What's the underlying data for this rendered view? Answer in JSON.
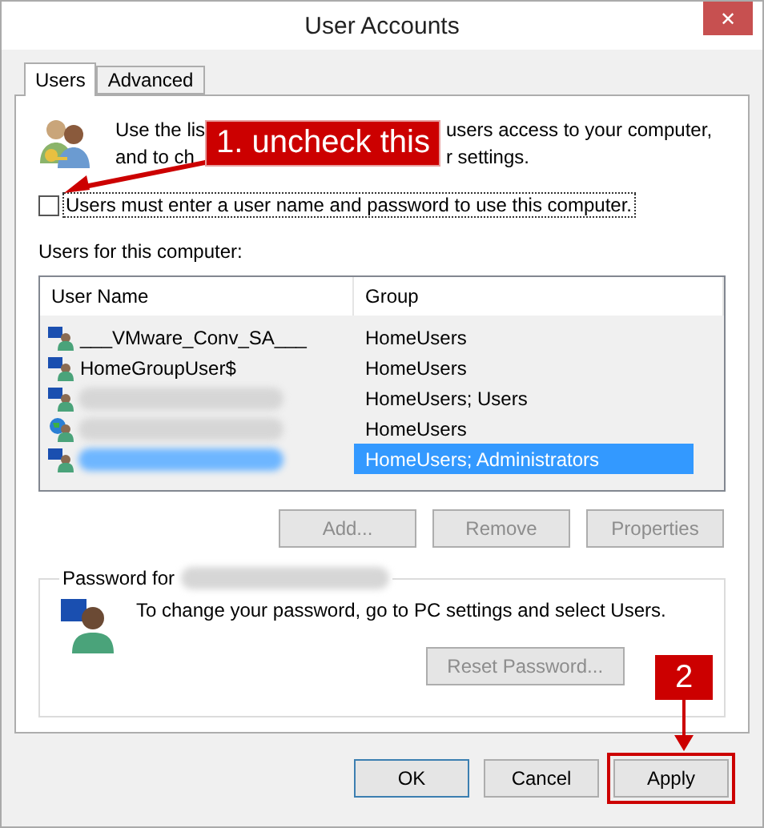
{
  "window": {
    "title": "User Accounts",
    "close": "✕"
  },
  "tabs": [
    {
      "label": "Users",
      "selected": true
    },
    {
      "label": "Advanced",
      "selected": false
    }
  ],
  "description": {
    "line_1": [
      "Use the lis",
      "users access to your computer,"
    ],
    "line_2": [
      "and to ch",
      "r settings."
    ]
  },
  "require_password": {
    "label": "Users must enter a user name and password to use this computer.",
    "checked": false
  },
  "users_label": "Users for this computer:",
  "table": {
    "columns": [
      "User Name",
      "Group"
    ],
    "rows": [
      {
        "name": "___VMware_Conv_SA___",
        "group": "HomeUsers",
        "kind": "local",
        "selected": false
      },
      {
        "name": "HomeGroupUser$",
        "group": "HomeUsers",
        "kind": "local",
        "selected": false
      },
      {
        "group": "HomeUsers; Users",
        "kind": "local",
        "selected": false
      },
      {
        "group": "HomeUsers",
        "kind": "online",
        "selected": false
      },
      {
        "group": "HomeUsers; Administrators",
        "kind": "local",
        "selected": true
      }
    ]
  },
  "list_buttons": [
    {
      "label": "Add...",
      "disabled": true
    },
    {
      "label": "Remove",
      "disabled": true
    },
    {
      "label": "Properties",
      "disabled": true
    }
  ],
  "password_group": {
    "title": "Password for",
    "message": "To change your password, go to PC settings and select Users.",
    "button": {
      "label": "Reset Password...",
      "disabled": true
    }
  },
  "buttons": [
    {
      "label": "OK",
      "kind": "default"
    },
    {
      "label": "Cancel",
      "kind": "normal"
    },
    {
      "label": "Apply",
      "kind": "highlighted"
    }
  ],
  "callouts": [
    {
      "text": "1. uncheck this"
    },
    {
      "text": "2"
    }
  ]
}
